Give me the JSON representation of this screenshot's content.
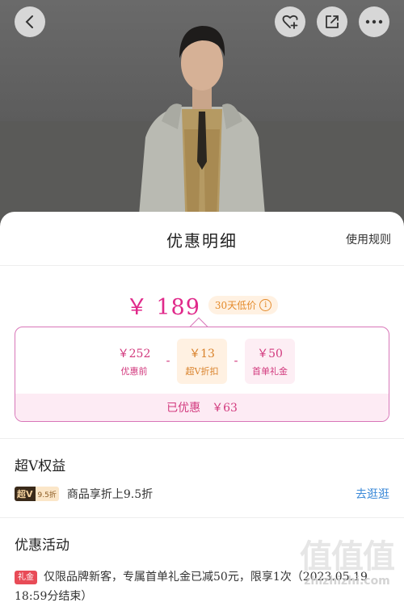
{
  "header": {
    "back_icon": "chevron-left-icon",
    "actions": [
      "heart-plus-icon",
      "share-icon",
      "more-icon"
    ]
  },
  "sheet": {
    "title": "优惠明细",
    "rules_link": "使用规则"
  },
  "price": {
    "final": "￥ 189",
    "low_badge": "30天低价",
    "info_icon": "i"
  },
  "breakdown": {
    "items": [
      {
        "amount": "￥252",
        "label": "优惠前"
      },
      {
        "amount": "￥13",
        "label": "超V折扣"
      },
      {
        "amount": "￥50",
        "label": "首单礼金"
      }
    ],
    "operators": [
      "-",
      "-"
    ],
    "saved_label": "已优惠",
    "saved_amount": "￥63"
  },
  "benefits": {
    "title": "超V权益",
    "tag_main": "超V",
    "tag_sub": "9.5折",
    "text": "商品享折上9.5折",
    "link": "去逛逛"
  },
  "activity": {
    "title": "优惠活动",
    "tag": "礼金",
    "text": "仅限品牌新客，专属首单礼金已减50元，限享1次（2023.05.19 18:59分结束）"
  },
  "watermark": {
    "logo": "值值值",
    "url": "zhizhizhi.com"
  },
  "colors": {
    "accent": "#e0298a",
    "border": "#d876b8",
    "badge": "#e48a2a",
    "link": "#3c8ad8"
  }
}
